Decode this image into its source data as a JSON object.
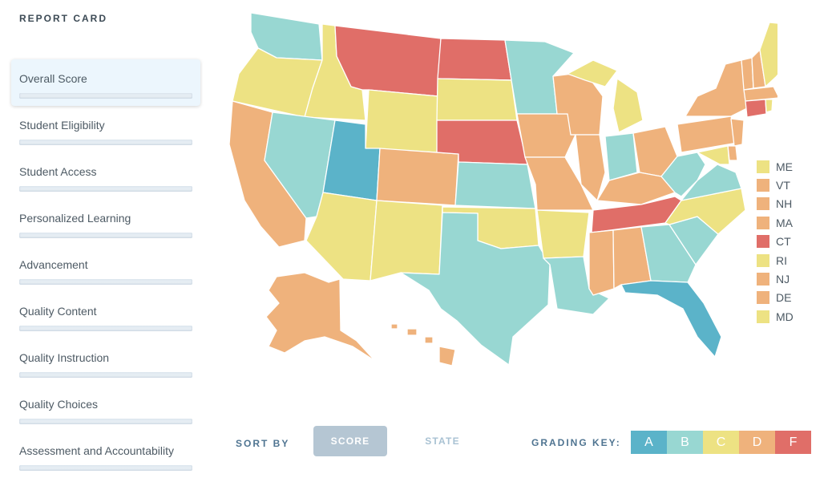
{
  "sidebar": {
    "title": "REPORT CARD",
    "items": [
      {
        "label": "Overall Score",
        "active": true
      },
      {
        "label": "Student Eligibility"
      },
      {
        "label": "Student Access"
      },
      {
        "label": "Personalized Learning"
      },
      {
        "label": "Advancement"
      },
      {
        "label": "Quality Content"
      },
      {
        "label": "Quality Instruction"
      },
      {
        "label": "Quality Choices"
      },
      {
        "label": "Assessment and Accountability"
      }
    ]
  },
  "grades": {
    "A": "#5bb3c9",
    "B": "#98d7d2",
    "C": "#ede283",
    "D": "#efb27c",
    "F": "#e06e68"
  },
  "legend": [
    {
      "state": "ME",
      "grade": "C"
    },
    {
      "state": "VT",
      "grade": "D"
    },
    {
      "state": "NH",
      "grade": "D"
    },
    {
      "state": "MA",
      "grade": "D"
    },
    {
      "state": "CT",
      "grade": "F"
    },
    {
      "state": "RI",
      "grade": "C"
    },
    {
      "state": "NJ",
      "grade": "D"
    },
    {
      "state": "DE",
      "grade": "D"
    },
    {
      "state": "MD",
      "grade": "C"
    }
  ],
  "controls": {
    "sort_by_label": "SORT BY",
    "score_label": "SCORE",
    "state_label": "STATE",
    "grading_key_label": "GRADING KEY:",
    "grading_key": [
      "A",
      "B",
      "C",
      "D",
      "F"
    ]
  }
}
